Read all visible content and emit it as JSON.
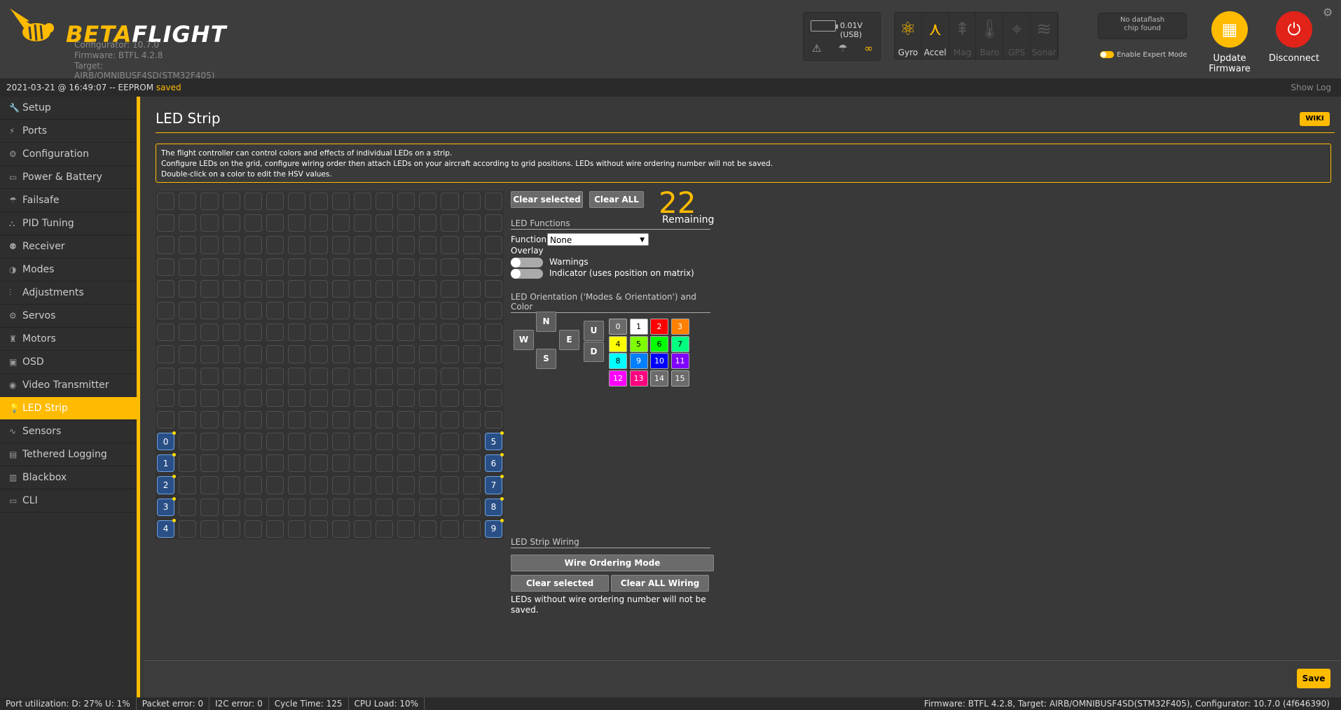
{
  "app": {
    "logo_text_beta": "BETA",
    "logo_text_flight": "FLIGHT",
    "configurator": "Configurator: 10.7.0",
    "firmware": "Firmware: BTFL 4.2.8",
    "target": "Target: AIRB/OMNIBUSF4SD(STM32F405)"
  },
  "header": {
    "battery": "0.01V (USB)",
    "battery_icons": [
      "warning-icon",
      "parachute-icon",
      "link-icon"
    ],
    "sensors": [
      {
        "label": "Gyro",
        "icon": "gyro-icon",
        "state": "on"
      },
      {
        "label": "Accel",
        "icon": "accel-icon",
        "state": "on"
      },
      {
        "label": "Mag",
        "icon": "mag-icon",
        "state": "off"
      },
      {
        "label": "Baro",
        "icon": "baro-icon",
        "state": "off"
      },
      {
        "label": "GPS",
        "icon": "gps-icon",
        "state": "off"
      },
      {
        "label": "Sonar",
        "icon": "sonar-icon",
        "state": "off"
      }
    ],
    "dataflash_line1": "No dataflash",
    "dataflash_line2": "chip found",
    "expert_mode": "Enable Expert Mode",
    "update_line1": "Update",
    "update_line2": "Firmware",
    "disconnect": "Disconnect"
  },
  "status": {
    "date": "2021-03-21 @ 16:49:07 -- EEPROM ",
    "saved": "saved",
    "show_log": "Show Log"
  },
  "sidebar": {
    "items": [
      {
        "label": "Setup",
        "icon": "wrench-icon"
      },
      {
        "label": "Ports",
        "icon": "plug-icon"
      },
      {
        "label": "Configuration",
        "icon": "gear-icon"
      },
      {
        "label": "Power & Battery",
        "icon": "battery-icon"
      },
      {
        "label": "Failsafe",
        "icon": "parachute-icon"
      },
      {
        "label": "PID Tuning",
        "icon": "sitemap-icon"
      },
      {
        "label": "Receiver",
        "icon": "robot-icon"
      },
      {
        "label": "Modes",
        "icon": "toggle-icon"
      },
      {
        "label": "Adjustments",
        "icon": "sliders-icon"
      },
      {
        "label": "Servos",
        "icon": "servo-icon"
      },
      {
        "label": "Motors",
        "icon": "motor-icon"
      },
      {
        "label": "OSD",
        "icon": "screen-icon"
      },
      {
        "label": "Video Transmitter",
        "icon": "broadcast-icon"
      },
      {
        "label": "LED Strip",
        "icon": "lightbulb-icon",
        "active": true
      },
      {
        "label": "Sensors",
        "icon": "pulse-icon"
      },
      {
        "label": "Tethered Logging",
        "icon": "log-icon"
      },
      {
        "label": "Blackbox",
        "icon": "blackbox-icon"
      },
      {
        "label": "CLI",
        "icon": "terminal-icon"
      }
    ]
  },
  "page": {
    "title": "LED Strip",
    "wiki": "WIKI",
    "note_line1": "The flight controller can control colors and effects of individual LEDs on a strip.",
    "note_line2": "Configure LEDs on the grid, configure wiring order then attach LEDs on your aircraft according to grid positions. LEDs without wire ordering number will not be saved.",
    "note_line3": "Double-click on a color to edit the HSV values."
  },
  "grid": {
    "wired": [
      {
        "index": "0",
        "row": 11,
        "col": 0
      },
      {
        "index": "1",
        "row": 12,
        "col": 0
      },
      {
        "index": "2",
        "row": 13,
        "col": 0
      },
      {
        "index": "3",
        "row": 14,
        "col": 0
      },
      {
        "index": "4",
        "row": 15,
        "col": 0
      },
      {
        "index": "5",
        "row": 11,
        "col": 15
      },
      {
        "index": "6",
        "row": 12,
        "col": 15
      },
      {
        "index": "7",
        "row": 13,
        "col": 15
      },
      {
        "index": "8",
        "row": 14,
        "col": 15
      },
      {
        "index": "9",
        "row": 15,
        "col": 15
      }
    ]
  },
  "panel": {
    "clear_selected": "Clear selected",
    "clear_all": "Clear ALL",
    "remaining_count": "22",
    "remaining_label": "Remaining",
    "functions_heading": "LED Functions",
    "function_label": "Function",
    "function_value": "None",
    "overlay_label": "Overlay",
    "warnings_label": "Warnings",
    "indicator_label": "Indicator (uses position on matrix)",
    "orientation_heading": "LED Orientation ('Modes & Orientation') and Color",
    "dirs": {
      "n": "N",
      "w": "W",
      "e": "E",
      "s": "S",
      "u": "U",
      "d": "D"
    },
    "colors": [
      {
        "label": "0",
        "bg": "#6b6b6b",
        "fg": "#ffffff"
      },
      {
        "label": "1",
        "bg": "#ffffff",
        "fg": "#000000"
      },
      {
        "label": "2",
        "bg": "#ff0000",
        "fg": "#ffffff"
      },
      {
        "label": "3",
        "bg": "#ff7f00",
        "fg": "#ffffff"
      },
      {
        "label": "4",
        "bg": "#ffff00",
        "fg": "#000000"
      },
      {
        "label": "5",
        "bg": "#7fff00",
        "fg": "#000000"
      },
      {
        "label": "6",
        "bg": "#00ff00",
        "fg": "#000000"
      },
      {
        "label": "7",
        "bg": "#00ff7f",
        "fg": "#000000"
      },
      {
        "label": "8",
        "bg": "#00ffff",
        "fg": "#000000"
      },
      {
        "label": "9",
        "bg": "#007fff",
        "fg": "#ffffff"
      },
      {
        "label": "10",
        "bg": "#0000ff",
        "fg": "#ffffff"
      },
      {
        "label": "11",
        "bg": "#7f00ff",
        "fg": "#ffffff"
      },
      {
        "label": "12",
        "bg": "#ff00ff",
        "fg": "#ffffff"
      },
      {
        "label": "13",
        "bg": "#ff007f",
        "fg": "#ffffff"
      },
      {
        "label": "14",
        "bg": "#6b6b6b",
        "fg": "#ffffff"
      },
      {
        "label": "15",
        "bg": "#6b6b6b",
        "fg": "#ffffff"
      }
    ],
    "wiring_heading": "LED Strip Wiring",
    "wire_ordering_mode": "Wire Ordering Mode",
    "wiring_clear_selected": "Clear selected",
    "clear_all_wiring": "Clear ALL Wiring",
    "wiring_note": "LEDs without wire ordering number will not be saved."
  },
  "save": "Save",
  "footer": {
    "port_util": "Port utilization: D: 27% U: 1%",
    "packet_error": "Packet error: 0",
    "i2c_error": "I2C error: 0",
    "cycle_time": "Cycle Time: 125",
    "cpu_load": "CPU Load: 10%",
    "right": "Firmware: BTFL 4.2.8, Target: AIRB/OMNIBUSF4SD(STM32F405), Configurator: 10.7.0 (4f646390)"
  },
  "colors": {
    "accent": "#ffbb00",
    "disconnect": "#e2231a",
    "wired_led": "#2a4f86"
  }
}
